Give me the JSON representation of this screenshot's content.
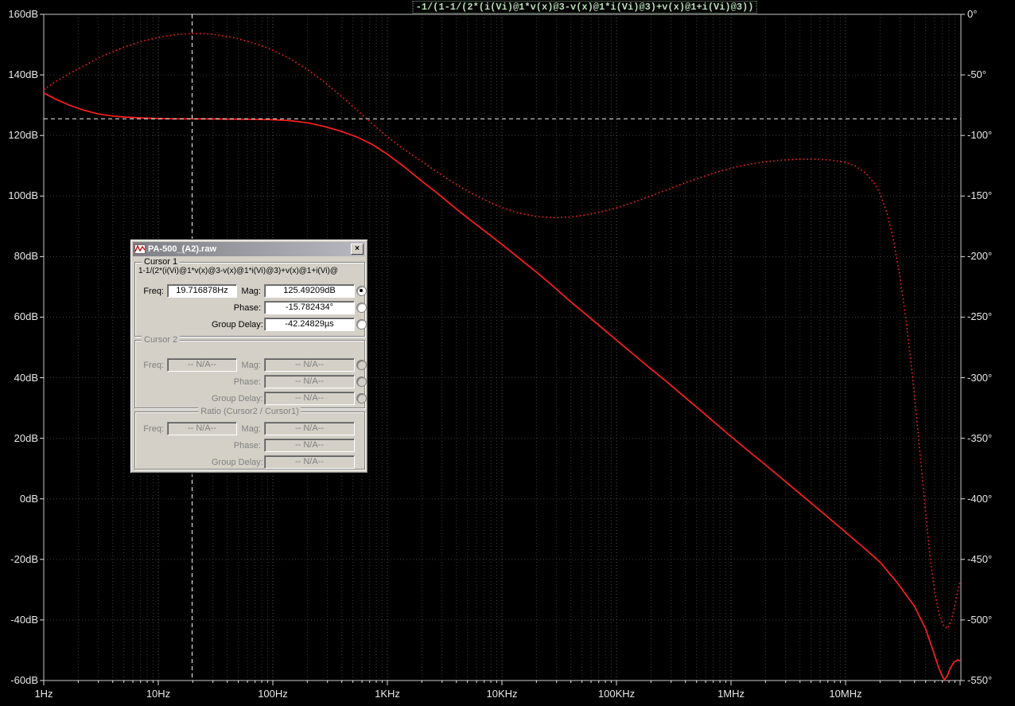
{
  "title": "-1/(1-1/(2*(i(Vi)@1*v(x)@3-v(x)@1*i(Vi)@3)+v(x)@1+i(Vi)@3))",
  "axes": {
    "left_labels": [
      "160dB",
      "140dB",
      "120dB",
      "100dB",
      "80dB",
      "60dB",
      "40dB",
      "20dB",
      "0dB",
      "-20dB",
      "-40dB",
      "-60dB"
    ],
    "right_labels": [
      "0°",
      "-50°",
      "-100°",
      "-150°",
      "-200°",
      "-250°",
      "-300°",
      "-350°",
      "-400°",
      "-450°",
      "-500°",
      "-550°"
    ],
    "bottom_labels": [
      "1Hz",
      "10Hz",
      "100Hz",
      "1KHz",
      "10KHz",
      "100KHz",
      "1MHz",
      "10MHz"
    ]
  },
  "dialog": {
    "title": "PA-500_(A2).raw",
    "close_glyph": "×",
    "cursor1": {
      "label": "Cursor 1",
      "expression": "1-1/(2*(i(Vi)@1*v(x)@3-v(x)@1*i(Vi)@3)+v(x)@1+i(Vi)@",
      "freq_label": "Freq:",
      "freq_value": "19.716878Hz",
      "mag_label": "Mag:",
      "mag_value": "125.49209dB",
      "phase_label": "Phase:",
      "phase_value": "-15.782434°",
      "group_delay_label": "Group Delay:",
      "group_delay_value": "-42.24829µs"
    },
    "cursor2": {
      "label": "Cursor 2",
      "freq_label": "Freq:",
      "mag_label": "Mag:",
      "phase_label": "Phase:",
      "group_delay_label": "Group Delay:",
      "na_value": "-- N/A--"
    },
    "ratio": {
      "label": "Ratio (Cursor2 / Cursor1)",
      "freq_label": "Freq:",
      "mag_label": "Mag:",
      "phase_label": "Phase:",
      "group_delay_label": "Group Delay:",
      "na_value": "-- N/A--"
    }
  },
  "chart_data": {
    "type": "line",
    "title": "-1/(1-1/(2*(i(Vi)@1*v(x)@3-v(x)@1*i(Vi)@3)+v(x)@1+i(Vi)@3))",
    "x_axis": {
      "scale": "log",
      "unit": "Hz",
      "min": 1,
      "max": 100000000,
      "tick_labels": [
        "1Hz",
        "10Hz",
        "100Hz",
        "1KHz",
        "10KHz",
        "100KHz",
        "1MHz",
        "10MHz"
      ]
    },
    "y_axis_left": {
      "unit": "dB",
      "min": -60,
      "max": 160,
      "step": 20
    },
    "y_axis_right": {
      "unit": "deg",
      "min": -550,
      "max": 0,
      "step": 50
    },
    "grid": true,
    "legend": false,
    "cursor": {
      "freq_hz": 19.716878,
      "mag_db": 125.49209,
      "phase_deg": -15.782434
    },
    "series": [
      {
        "name": "magnitude_dB",
        "axis": "left",
        "style": "solid",
        "color": "#ff1f1f",
        "points": [
          [
            1,
            134
          ],
          [
            1.3,
            131.8
          ],
          [
            1.7,
            129.9
          ],
          [
            2.2,
            128.4
          ],
          [
            3,
            127.1
          ],
          [
            4,
            126.4
          ],
          [
            5,
            126.1
          ],
          [
            7,
            125.8
          ],
          [
            10,
            125.6
          ],
          [
            14,
            125.5
          ],
          [
            19.7,
            125.49
          ],
          [
            28,
            125.45
          ],
          [
            40,
            125.4
          ],
          [
            60,
            125.35
          ],
          [
            85,
            125.25
          ],
          [
            100,
            125.2
          ],
          [
            140,
            124.9
          ],
          [
            200,
            124.2
          ],
          [
            280,
            123
          ],
          [
            400,
            121.3
          ],
          [
            550,
            119.4
          ],
          [
            750,
            116.9
          ],
          [
            1000,
            113.8
          ],
          [
            1400,
            109.7
          ],
          [
            2000,
            104.9
          ],
          [
            2800,
            100.6
          ],
          [
            4000,
            95.7
          ],
          [
            5500,
            91.6
          ],
          [
            7500,
            87.7
          ],
          [
            10000,
            84
          ],
          [
            14000,
            79.6
          ],
          [
            20000,
            74.9
          ],
          [
            28000,
            70.2
          ],
          [
            40000,
            65
          ],
          [
            55000,
            60.7
          ],
          [
            75000,
            56.4
          ],
          [
            100000,
            52.4
          ],
          [
            140000,
            47.8
          ],
          [
            200000,
            42.9
          ],
          [
            280000,
            38.4
          ],
          [
            400000,
            33.4
          ],
          [
            550000,
            29
          ],
          [
            750000,
            24.6
          ],
          [
            1000000,
            20.6
          ],
          [
            1400000,
            16
          ],
          [
            2000000,
            11.2
          ],
          [
            2800000,
            6.6
          ],
          [
            4000000,
            1.7
          ],
          [
            5500000,
            -2.7
          ],
          [
            7500000,
            -7
          ],
          [
            10000000,
            -11
          ],
          [
            14000000,
            -15.7
          ],
          [
            20000000,
            -20.9
          ],
          [
            28000000,
            -27.5
          ],
          [
            40000000,
            -35.5
          ],
          [
            50000000,
            -43
          ],
          [
            58000000,
            -50
          ],
          [
            65000000,
            -55.8
          ],
          [
            70000000,
            -58.6
          ],
          [
            73000000,
            -59.7
          ],
          [
            77000000,
            -58.6
          ],
          [
            82000000,
            -56
          ],
          [
            88000000,
            -54
          ],
          [
            95000000,
            -53.2
          ],
          [
            100000000,
            -53.5
          ]
        ]
      },
      {
        "name": "phase_deg",
        "axis": "right",
        "style": "dotted",
        "color": "#ff1f1f",
        "points": [
          [
            1,
            -62
          ],
          [
            1.3,
            -55
          ],
          [
            1.7,
            -48.5
          ],
          [
            2.2,
            -43
          ],
          [
            3,
            -36
          ],
          [
            4,
            -30.8
          ],
          [
            5,
            -27.2
          ],
          [
            7,
            -22.6
          ],
          [
            10,
            -19.1
          ],
          [
            14,
            -16.8
          ],
          [
            19.7,
            -15.78
          ],
          [
            25,
            -15.9
          ],
          [
            32,
            -16.8
          ],
          [
            45,
            -19.2
          ],
          [
            60,
            -22.2
          ],
          [
            85,
            -26.8
          ],
          [
            100,
            -29.6
          ],
          [
            140,
            -36.5
          ],
          [
            200,
            -45.5
          ],
          [
            280,
            -55.8
          ],
          [
            400,
            -68
          ],
          [
            550,
            -79.5
          ],
          [
            750,
            -91
          ],
          [
            1000,
            -101
          ],
          [
            1400,
            -111.5
          ],
          [
            2000,
            -121.5
          ],
          [
            2800,
            -131
          ],
          [
            4000,
            -140.5
          ],
          [
            5500,
            -148
          ],
          [
            7500,
            -154.3
          ],
          [
            10000,
            -159.5
          ],
          [
            14000,
            -164
          ],
          [
            20000,
            -166.9
          ],
          [
            28000,
            -167.9
          ],
          [
            40000,
            -167.3
          ],
          [
            55000,
            -165.5
          ],
          [
            75000,
            -162.8
          ],
          [
            100000,
            -159.8
          ],
          [
            140000,
            -155.3
          ],
          [
            200000,
            -150
          ],
          [
            280000,
            -144.6
          ],
          [
            400000,
            -139
          ],
          [
            550000,
            -134.5
          ],
          [
            750000,
            -130.3
          ],
          [
            1000000,
            -127
          ],
          [
            1400000,
            -124
          ],
          [
            2000000,
            -121.7
          ],
          [
            2800000,
            -120.3
          ],
          [
            4000000,
            -119.6
          ],
          [
            5500000,
            -119.6
          ],
          [
            7500000,
            -120.3
          ],
          [
            10000000,
            -122.3
          ],
          [
            12000000,
            -125
          ],
          [
            15000000,
            -131
          ],
          [
            18000000,
            -140
          ],
          [
            20000000,
            -148
          ],
          [
            23000000,
            -164
          ],
          [
            26000000,
            -185
          ],
          [
            30000000,
            -218
          ],
          [
            34000000,
            -255
          ],
          [
            38000000,
            -295
          ],
          [
            42000000,
            -335
          ],
          [
            46000000,
            -375
          ],
          [
            50000000,
            -412
          ],
          [
            55000000,
            -450
          ],
          [
            60000000,
            -477
          ],
          [
            66000000,
            -496
          ],
          [
            72000000,
            -505
          ],
          [
            78000000,
            -507
          ],
          [
            84000000,
            -500
          ],
          [
            90000000,
            -488
          ],
          [
            95000000,
            -477
          ],
          [
            100000000,
            -468
          ]
        ]
      }
    ]
  }
}
